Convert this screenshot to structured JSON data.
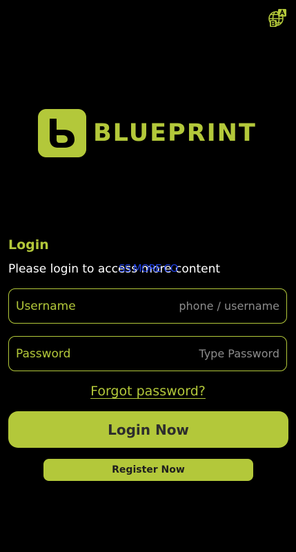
{
  "colors": {
    "accent": "#b3c83a",
    "background": "#000000",
    "overlay_blue": "#1f3fe0",
    "placeholder": "#8c8c8c"
  },
  "header": {
    "language_icon": "language-translate-icon"
  },
  "brand": {
    "logo_icon": "blueprint-b-logo-icon",
    "name": "BLUEPRINT"
  },
  "login": {
    "title": "Login",
    "subtitle": "Please login to access more content",
    "overlay_text": "SS MORE CO"
  },
  "form": {
    "username": {
      "label": "Username",
      "value": "",
      "placeholder": "phone / username"
    },
    "password": {
      "label": "Password",
      "value": "",
      "placeholder": "Type Password"
    },
    "forgot_label": "Forgot password?",
    "login_button": "Login Now",
    "register_button": "Register Now"
  }
}
